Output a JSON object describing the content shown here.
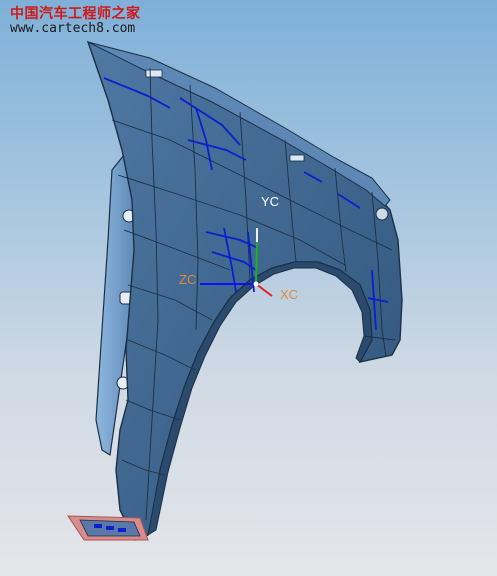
{
  "watermark": {
    "title": "中国汽车工程师之家",
    "url": "www.cartech8.com"
  },
  "triad": {
    "yc": "YC",
    "zc": "ZC",
    "xc": "XC"
  },
  "colors": {
    "part_fill": "#40678e",
    "part_edge": "#1d2f44",
    "surface_lines": "#0a1fd0",
    "triad_x": "#e02020",
    "triad_y": "#20b020",
    "triad_z": "#1010ff",
    "label_orange": "#e08a3a"
  }
}
